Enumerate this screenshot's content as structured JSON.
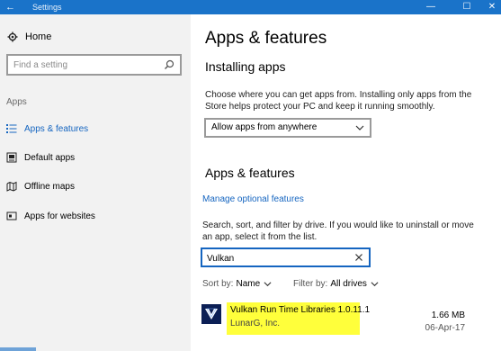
{
  "window": {
    "title": "Settings",
    "accent": "#1a73c9"
  },
  "sidebar": {
    "home_label": "Home",
    "search_placeholder": "Find a setting",
    "section_label": "Apps",
    "items": [
      {
        "label": "Apps & features",
        "icon": "list-icon",
        "active": true
      },
      {
        "label": "Default apps",
        "icon": "default-apps-icon",
        "active": false
      },
      {
        "label": "Offline maps",
        "icon": "map-icon",
        "active": false
      },
      {
        "label": "Apps for websites",
        "icon": "web-app-icon",
        "active": false
      }
    ]
  },
  "main": {
    "title": "Apps & features",
    "installing": {
      "heading": "Installing apps",
      "description": "Choose where you can get apps from. Installing only apps from the Store helps protect your PC and keep it running smoothly.",
      "dropdown_value": "Allow apps from anywhere"
    },
    "apps": {
      "heading": "Apps & features",
      "manage_link": "Manage optional features",
      "description": "Search, sort, and filter by drive. If you would like to uninstall or move an app, select it from the list.",
      "filter_value": "Vulkan",
      "sort_label": "Sort by:",
      "sort_value": "Name",
      "filter_label": "Filter by:",
      "filter_drive": "All drives",
      "list": [
        {
          "name": "Vulkan Run Time Libraries 1.0.11.1",
          "publisher": "LunarG, Inc.",
          "size": "1.66 MB",
          "date": "06-Apr-17",
          "highlight_color": "#ffff3b"
        }
      ]
    }
  }
}
